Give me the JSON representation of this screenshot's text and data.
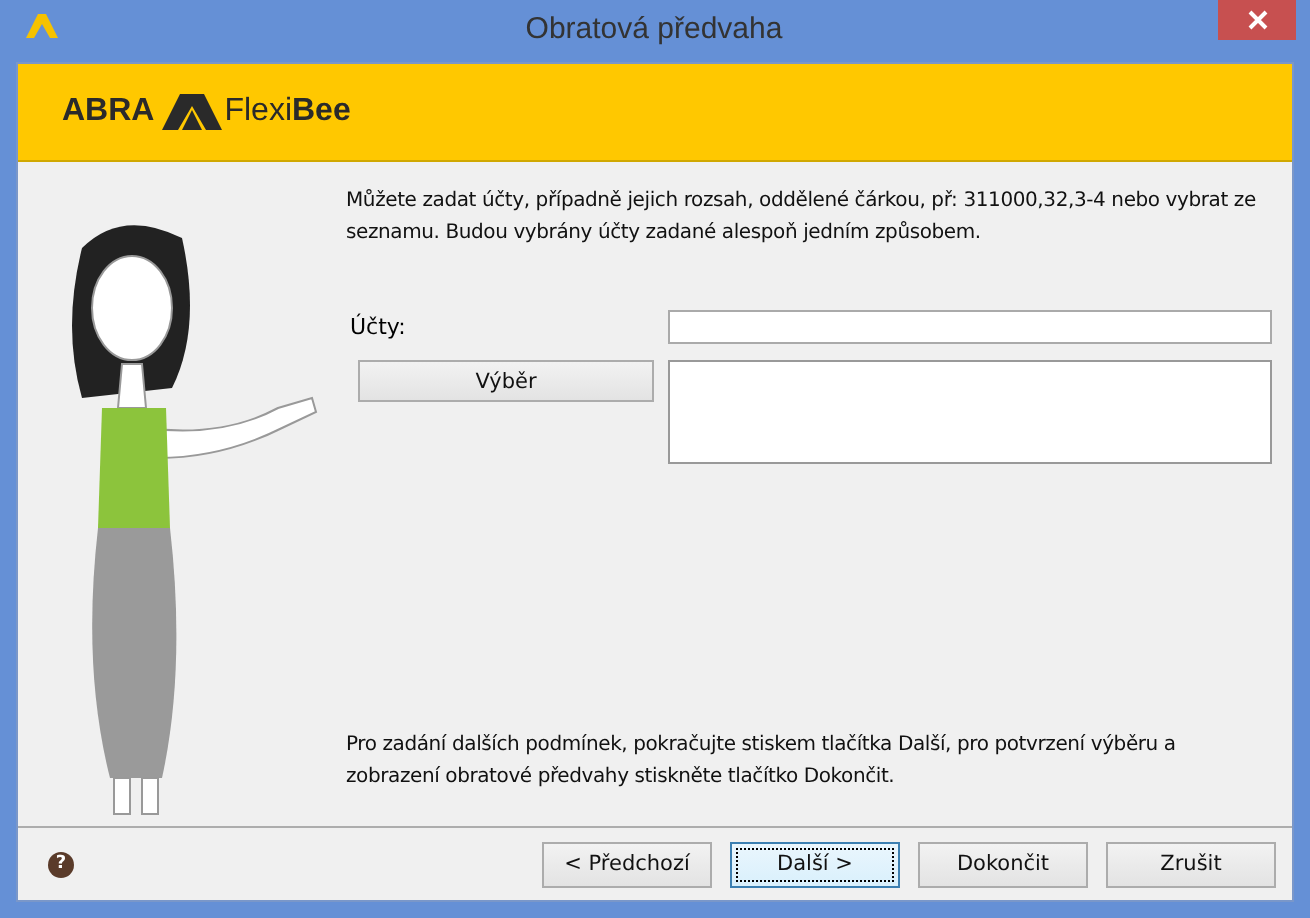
{
  "window": {
    "title": "Obratová předvaha"
  },
  "banner": {
    "logo_left": "ABRA",
    "logo_right": "Flexi**Bee**"
  },
  "intro": "Můžete zadat účty, případně jejich rozsah, oddělené čárkou, př: 311000,32,3-4 nebo vybrat ze seznamu. Budou vybrány účty zadané alespoň jedním způsobem.",
  "accounts": {
    "label": "Účty:"
  },
  "select_button": "Výběr",
  "hint": "Pro zadání dalších podmínek, pokračujte stiskem tlačítka Další, pro potvrzení výběru a zobrazení obratové předvahy stiskněte tlačítko Dokončit.",
  "help": "?",
  "buttons": [
    {
      "label": "< Předchozí",
      "focused": false
    },
    {
      "label": "Další >",
      "focused": true
    },
    {
      "label": "Dokončit",
      "focused": false
    },
    {
      "label": "Zrušit",
      "focused": false
    }
  ]
}
